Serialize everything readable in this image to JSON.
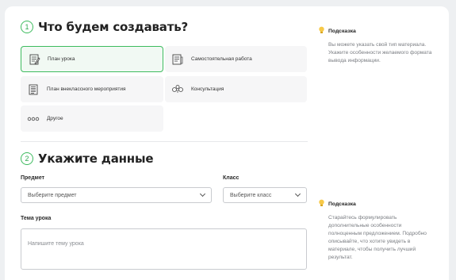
{
  "step1": {
    "number": "1",
    "title": "Что будем создавать?"
  },
  "options": [
    {
      "label": "План урока",
      "icon": "lesson-plan-icon"
    },
    {
      "label": "Самостоятельная работа",
      "icon": "independent-work-icon"
    },
    {
      "label": "План внеклассного мероприятия",
      "icon": "event-plan-icon"
    },
    {
      "label": "Консультация",
      "icon": "consultation-icon"
    },
    {
      "label": "Другое",
      "icon": "other-icon"
    }
  ],
  "hint1": {
    "title": "Подсказка",
    "text": "Вы можете указать свой тип материала. Укажите особенности желаемого формата вывода информации.",
    "icon": "lightbulb-icon"
  },
  "step2": {
    "number": "2",
    "title": "Укажите данные"
  },
  "subject": {
    "label": "Предмет",
    "value": "Выберите предмет"
  },
  "grade": {
    "label": "Класс",
    "value": "Выберите класс"
  },
  "topic": {
    "label": "Тема урока",
    "placeholder": "Напишите тему урока"
  },
  "hint2": {
    "title": "Подсказка",
    "text": "Старайтесь формулировать дополнительные особенности полноценным предложением. Подробно описывайте, что хотите увидеть в материале, чтобы получить лучший результат.",
    "icon": "lightbulb-icon"
  },
  "colors": {
    "accent": "#3dbb5e",
    "selected_bg": "#f1f9f3",
    "option_bg": "#f6f6f7"
  }
}
